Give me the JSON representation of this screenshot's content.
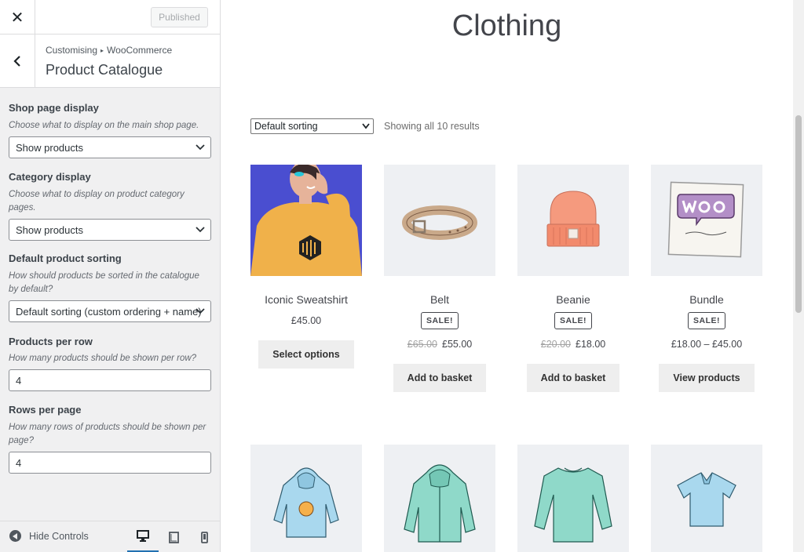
{
  "customizer": {
    "publish_label": "Published",
    "breadcrumb": {
      "root": "Customising",
      "parent": "WooCommerce"
    },
    "section_title": "Product Catalogue",
    "controls": {
      "shop_display": {
        "label": "Shop page display",
        "description": "Choose what to display on the main shop page.",
        "value": "Show products"
      },
      "category_display": {
        "label": "Category display",
        "description": "Choose what to display on product category pages.",
        "value": "Show products"
      },
      "default_sorting": {
        "label": "Default product sorting",
        "description": "How should products be sorted in the catalogue by default?",
        "value": "Default sorting (custom ordering + name)"
      },
      "products_per_row": {
        "label": "Products per row",
        "description": "How many products should be shown per row?",
        "value": "4"
      },
      "rows_per_page": {
        "label": "Rows per page",
        "description": "How many rows of products should be shown per page?",
        "value": "4"
      }
    },
    "footer": {
      "hide_controls_label": "Hide Controls",
      "active_device": "desktop"
    }
  },
  "preview": {
    "page_title": "Clothing",
    "sorting_value": "Default sorting",
    "result_count": "Showing all 10 results",
    "products": [
      {
        "title": "Iconic Sweatshirt",
        "price": "£45.00",
        "old_price": "",
        "sale_badge": "",
        "button": "Select options",
        "image": "sweatshirt-photo"
      },
      {
        "title": "Belt",
        "price": "£55.00",
        "old_price": "£65.00",
        "sale_badge": "SALE!",
        "button": "Add to basket",
        "image": "belt-illustration"
      },
      {
        "title": "Beanie",
        "price": "£18.00",
        "old_price": "£20.00",
        "sale_badge": "SALE!",
        "button": "Add to basket",
        "image": "beanie-illustration"
      },
      {
        "title": "Bundle",
        "price": "£18.00 – £45.00",
        "old_price": "",
        "sale_badge": "SALE!",
        "button": "View products",
        "image": "woo-album-illustration"
      }
    ],
    "second_row_images": [
      "hoodie-with-logo-illustration",
      "zip-hoodie-illustration",
      "long-sleeve-tee-illustration",
      "polo-illustration"
    ]
  },
  "colors": {
    "sidebar_bg": "#f0f0f1",
    "accent": "#2271b1",
    "thumb_bg": "#eef0f3",
    "button_bg": "#eeeeee",
    "sweatshirt_bg": "#4a4ed0",
    "sweatshirt": "#f0b14a",
    "mint_garment": "#8fd9c9",
    "light_blue_garment": "#a9d8ee",
    "beanie": "#f59a7e"
  }
}
